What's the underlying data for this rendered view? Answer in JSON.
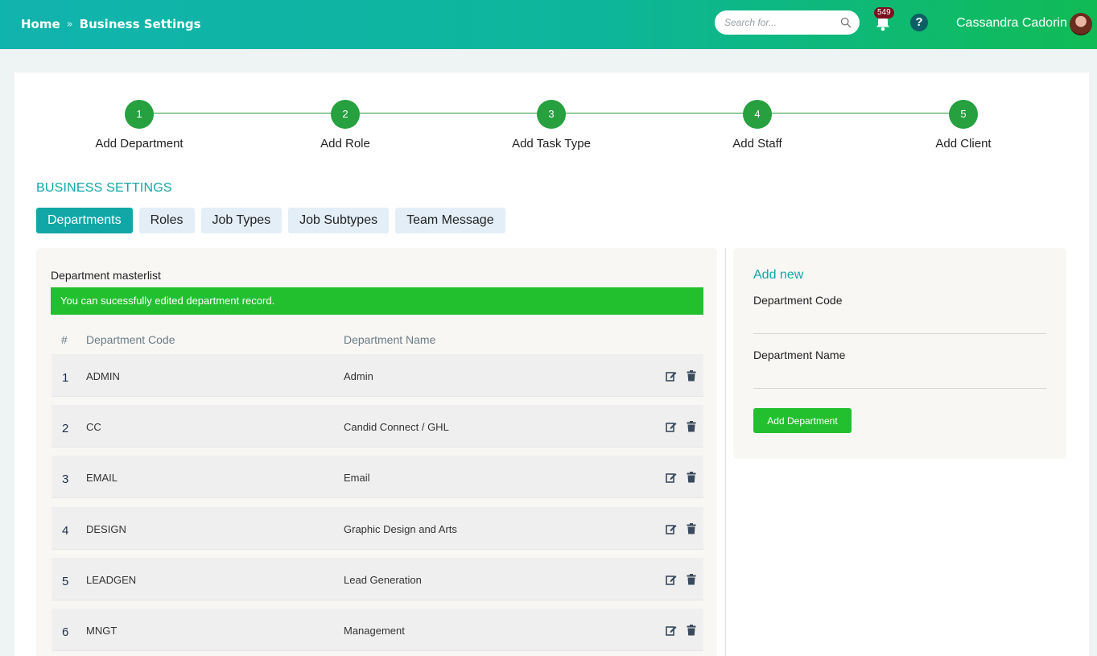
{
  "header": {
    "breadcrumb": [
      "Home",
      "Business Settings"
    ],
    "breadcrumb_separator": "»",
    "search_placeholder": "Search for...",
    "notification_count": "549",
    "help_icon": "?",
    "user_name": "Cassandra Cadorin"
  },
  "steps": [
    {
      "number": "1",
      "label": "Add Department"
    },
    {
      "number": "2",
      "label": "Add Role"
    },
    {
      "number": "3",
      "label": "Add Task Type"
    },
    {
      "number": "4",
      "label": "Add Staff"
    },
    {
      "number": "5",
      "label": "Add Client"
    }
  ],
  "section_title": "BUSINESS SETTINGS",
  "tabs": [
    {
      "label": "Departments",
      "active": true
    },
    {
      "label": "Roles"
    },
    {
      "label": "Job Types"
    },
    {
      "label": "Job Subtypes"
    },
    {
      "label": "Team Message"
    }
  ],
  "masterlist": {
    "title": "Department masterlist",
    "alert": "You can sucessfully edited department record.",
    "columns": [
      "#",
      "Department Code",
      "Department Name"
    ],
    "rows": [
      {
        "num": "1",
        "code": "ADMIN",
        "name": "Admin"
      },
      {
        "num": "2",
        "code": "CC",
        "name": "Candid Connect / GHL"
      },
      {
        "num": "3",
        "code": "EMAIL",
        "name": "Email"
      },
      {
        "num": "4",
        "code": "DESIGN",
        "name": "Graphic Design and Arts"
      },
      {
        "num": "5",
        "code": "LEADGEN",
        "name": "Lead Generation"
      },
      {
        "num": "6",
        "code": "MNGT",
        "name": "Management"
      }
    ]
  },
  "add_new": {
    "title": "Add new",
    "code_label": "Department Code",
    "name_label": "Department Name",
    "button": "Add Department"
  },
  "colors": {
    "accent": "#11a7a6",
    "success": "#22c02e",
    "step": "#27a03f",
    "badge": "#7a1020"
  }
}
